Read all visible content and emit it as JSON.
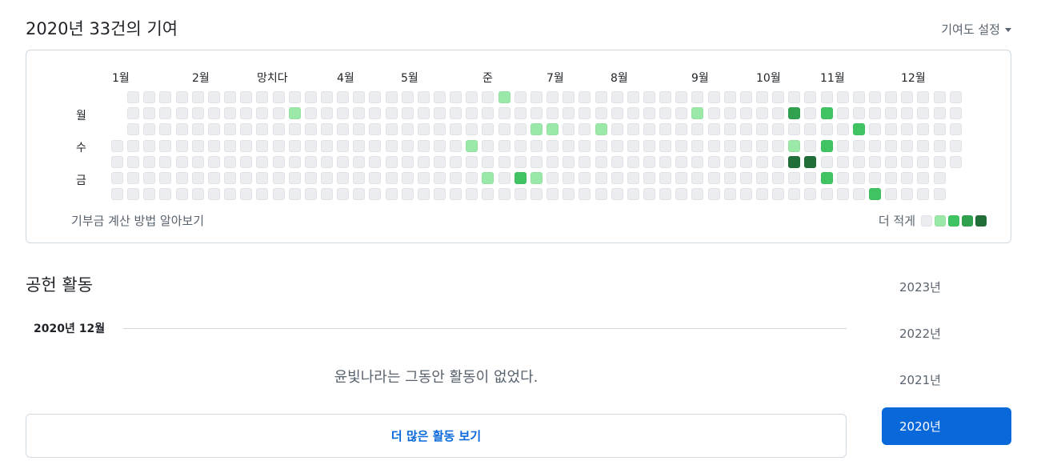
{
  "header": {
    "title": "2020년 33건의 기여",
    "settings_label": "기여도 설정"
  },
  "calendar": {
    "months": [
      "1월",
      "2월",
      "망치다",
      "4월",
      "5월",
      "준",
      "7월",
      "8월",
      "9월",
      "10월",
      "11월",
      "12월"
    ],
    "days": [
      "월",
      "수",
      "금"
    ],
    "learn_link": "기부금 계산 방법 알아보기",
    "legend_label": "더 적게",
    "legend_colors": [
      "#ebedf0",
      "#9be9a8",
      "#40c463",
      "#30a14e",
      "#216e39"
    ],
    "total_weeks": 53,
    "first_day_row": 3,
    "last_day_row": 4,
    "contributions": [
      {
        "week": 24,
        "day": 0,
        "level": 1
      },
      {
        "week": 11,
        "day": 1,
        "level": 1
      },
      {
        "week": 36,
        "day": 1,
        "level": 1
      },
      {
        "week": 42,
        "day": 1,
        "level": 3
      },
      {
        "week": 44,
        "day": 1,
        "level": 2
      },
      {
        "week": 26,
        "day": 2,
        "level": 1
      },
      {
        "week": 27,
        "day": 2,
        "level": 1
      },
      {
        "week": 30,
        "day": 2,
        "level": 1
      },
      {
        "week": 46,
        "day": 2,
        "level": 2
      },
      {
        "week": 22,
        "day": 3,
        "level": 1
      },
      {
        "week": 42,
        "day": 3,
        "level": 1
      },
      {
        "week": 44,
        "day": 3,
        "level": 2
      },
      {
        "week": 42,
        "day": 4,
        "level": 4
      },
      {
        "week": 43,
        "day": 4,
        "level": 4
      },
      {
        "week": 23,
        "day": 5,
        "level": 1
      },
      {
        "week": 25,
        "day": 5,
        "level": 2
      },
      {
        "week": 26,
        "day": 5,
        "level": 1
      },
      {
        "week": 44,
        "day": 5,
        "level": 2
      },
      {
        "week": 47,
        "day": 6,
        "level": 2
      }
    ]
  },
  "activity": {
    "heading": "공헌 활동",
    "month_heading": "2020년 12월",
    "empty_message": "윤빛나라는 그동안 활동이 없었다.",
    "more_button": "더 많은 활동 보기"
  },
  "years": [
    {
      "label": "2023년",
      "active": false
    },
    {
      "label": "2022년",
      "active": false
    },
    {
      "label": "2021년",
      "active": false
    },
    {
      "label": "2020년",
      "active": true
    }
  ]
}
